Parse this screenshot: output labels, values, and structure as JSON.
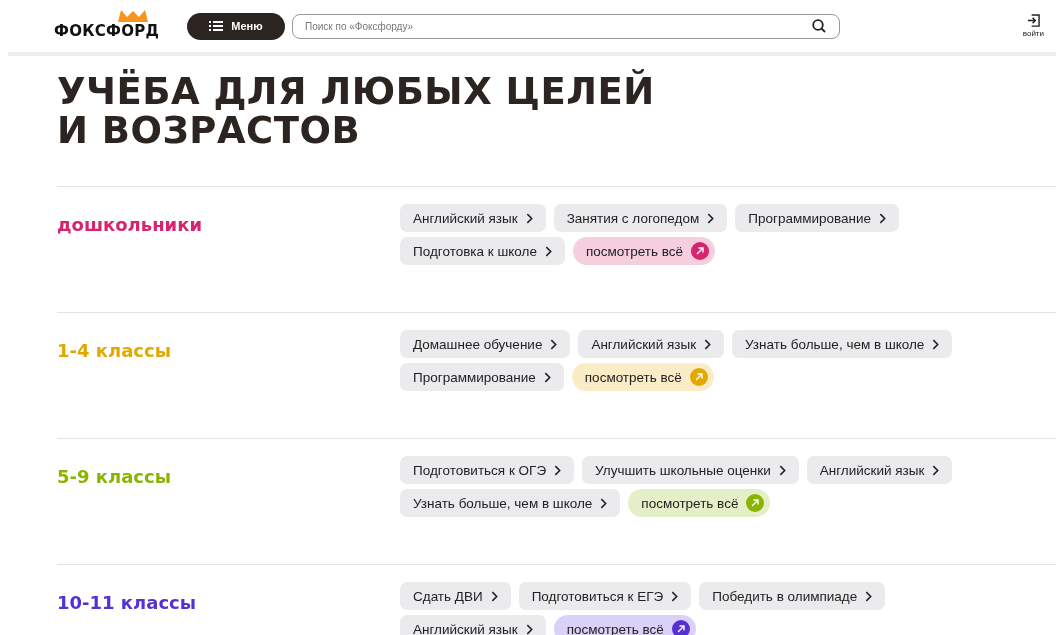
{
  "header": {
    "logo": "ФОКСФОРД",
    "menu_button": "Меню",
    "search": {
      "placeholder": "Поиск по «Фоксфорду»"
    },
    "login": "войти"
  },
  "title": [
    "УЧЁБА ДЛЯ ЛЮБЫХ ЦЕЛЕЙ",
    "И ВОЗРАСТОВ"
  ],
  "sections": [
    {
      "title": "дошкольники",
      "color": "#d6246e",
      "links": [
        "Английский язык",
        "Занятия с логопедом",
        "Программирование",
        "Подготовка к школе"
      ],
      "see_all": "посмотреть всё"
    },
    {
      "title": "1-4 классы",
      "color": "#e3a800",
      "links": [
        "Домашнее обучение",
        "Английский язык",
        "Узнать больше, чем в школе",
        "Программирование"
      ],
      "see_all": "посмотреть всё"
    },
    {
      "title": "5-9 классы",
      "color": "#8bb400",
      "links": [
        "Подготовиться к ОГЭ",
        "Улучшить школьные оценки",
        "Английский язык",
        "Узнать больше, чем в школе"
      ],
      "see_all": "посмотреть всё"
    },
    {
      "title": "10-11 классы",
      "color": "#5530d4",
      "links": [
        "Сдать ДВИ",
        "Подготовиться к ЕГЭ",
        "Победить в олимпиаде",
        "Английский язык"
      ],
      "see_all": "посмотреть всё"
    }
  ]
}
